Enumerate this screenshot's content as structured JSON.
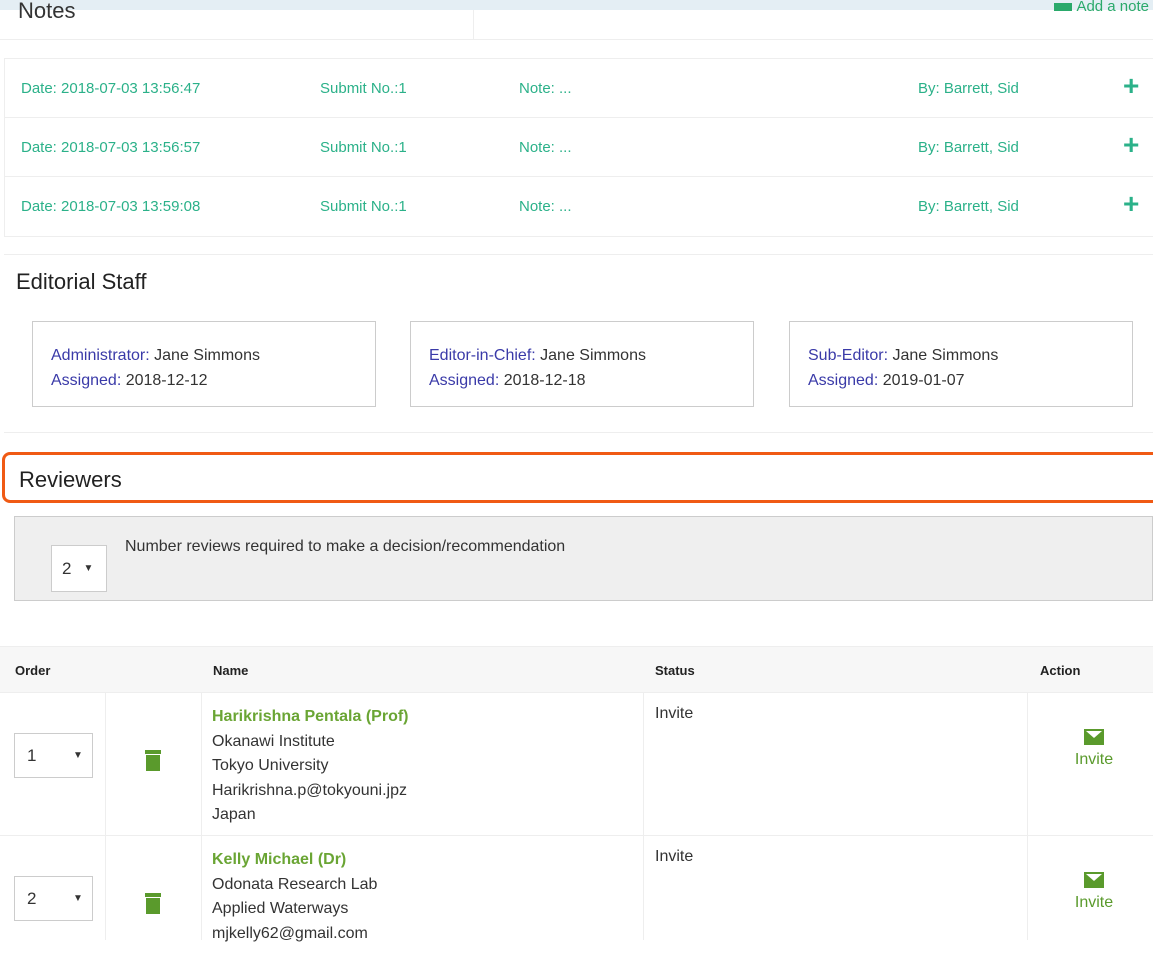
{
  "notes": {
    "title": "Notes",
    "add_note_label": "Add a note",
    "rows": [
      {
        "date": "Date: 2018-07-03 13:56:47",
        "submit": "Submit No.:1",
        "note": "Note: ...",
        "by": "By: Barrett, Sid",
        "icon": "plus-icon"
      },
      {
        "date": "Date: 2018-07-03 13:56:57",
        "submit": "Submit No.:1",
        "note": "Note: ...",
        "by": "By: Barrett, Sid",
        "icon": "plus-icon"
      },
      {
        "date": "Date: 2018-07-03 13:59:08",
        "submit": "Submit No.:1",
        "note": "Note: ...",
        "by": "By: Barrett, Sid",
        "icon": "plus-icon"
      }
    ]
  },
  "editorial_staff": {
    "title": "Editorial Staff",
    "cards": [
      {
        "role_label": "Administrator:",
        "name": " Jane Simmons",
        "assigned_label": "Assigned:",
        "assigned": " 2018-12-12"
      },
      {
        "role_label": "Editor-in-Chief:",
        "name": " Jane Simmons",
        "assigned_label": "Assigned:",
        "assigned": " 2018-12-18"
      },
      {
        "role_label": "Sub-Editor:",
        "name": " Jane Simmons",
        "assigned_label": "Assigned:",
        "assigned": " 2019-01-07"
      }
    ]
  },
  "reviewers": {
    "title": "Reviewers",
    "required_value": "2",
    "required_label": "Number reviews required to make a decision/recommendation",
    "table": {
      "headers": {
        "order": "Order",
        "name": "Name",
        "status": "Status",
        "action": "Action"
      },
      "rows": [
        {
          "order": "1",
          "name": "Harikrishna Pentala (Prof)",
          "line1": "Okanawi Institute",
          "line2": "Tokyo University",
          "line3": "Harikrishna.p@tokyouni.jpz",
          "line4": "Japan",
          "status": "Invite",
          "action": "Invite"
        },
        {
          "order": "2",
          "name": "Kelly Michael (Dr)",
          "line1": "Odonata Research Lab",
          "line2": "Applied Waterways",
          "line3": "mjkelly62@gmail.com",
          "line4": "",
          "status": "Invite",
          "action": "Invite"
        }
      ]
    }
  },
  "colors": {
    "accent_green": "#2bb189",
    "reviewer_green": "#6aa534",
    "label_blue": "#3a3aa8",
    "highlight_orange": "#f05a14"
  }
}
